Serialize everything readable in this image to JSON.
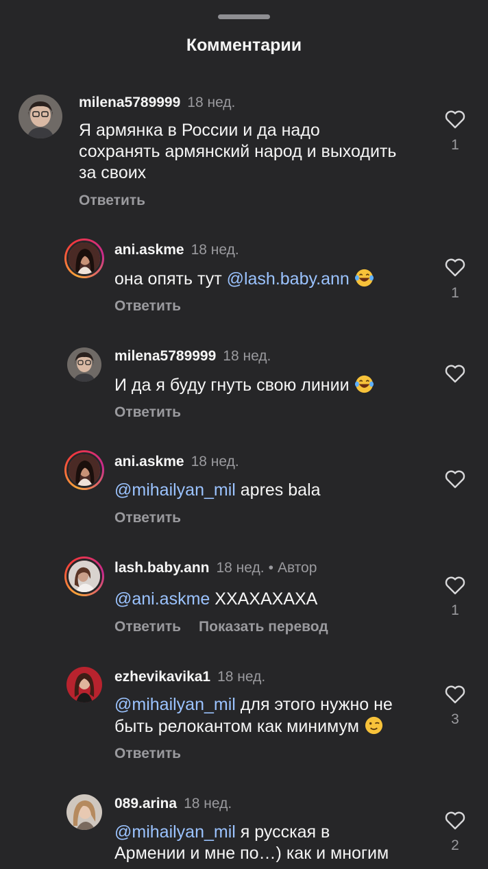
{
  "sheet": {
    "title": "Комментарии"
  },
  "labels": {
    "reply": "Ответить",
    "show_translation": "Показать перевод",
    "author_badge": "Автор",
    "dot": "•"
  },
  "comments": [
    {
      "username": "milena5789999",
      "time": "18 нед.",
      "line1": "Я армянка в России и да надо",
      "line2": "сохранять армянский народ и выходить",
      "line3": "за своих",
      "likes": "1"
    },
    {
      "username": "ani.askme",
      "time": "18 нед.",
      "text": "она опять тут ",
      "mention": "@lash.baby.ann",
      "emoji": "face-with-tears-of-joy",
      "likes": "1"
    },
    {
      "username": "milena5789999",
      "time": "18 нед.",
      "text": "И да я буду гнуть свою линии ",
      "emoji": "face-with-tears-of-joy"
    },
    {
      "username": "ani.askme",
      "time": "18 нед.",
      "mention": "@mihailyan_mil",
      "text": " apres bala"
    },
    {
      "username": "lash.baby.ann",
      "time": "18 нед.",
      "mention": "@ani.askme",
      "text": " ХХАХАХАХА",
      "likes": "1"
    },
    {
      "username": "ezhevikavika1",
      "time": "18 нед.",
      "mention": "@mihailyan_mil",
      "line1_rest": " для этого нужно не",
      "line2": "быть релокантом как минимум ",
      "emoji": "winking-face",
      "likes": "3"
    },
    {
      "username": "089.arina",
      "time": "18 нед.",
      "mention": "@mihailyan_mil",
      "line1_rest": " я русская в",
      "line2": "Армении и мне по…) как и многим",
      "likes": "2"
    }
  ],
  "colors": {
    "background": "#262628",
    "mention": "#9bc3ff",
    "muted": "#9a9a9e",
    "text": "#f5f5f5"
  }
}
